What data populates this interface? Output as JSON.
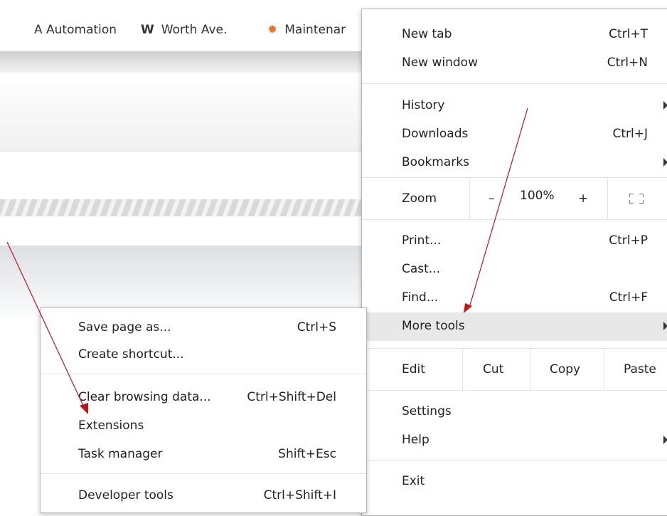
{
  "bookmarks": [
    {
      "icon": "automation-icon",
      "label": "A Automation"
    },
    {
      "icon": "worth-ave-icon",
      "glyph": "W",
      "label": "Worth Ave."
    },
    {
      "icon": "maintenance-icon",
      "glyph": "✹",
      "label": "Maintenar"
    }
  ],
  "main_menu": {
    "new_tab": {
      "label": "New tab",
      "shortcut": "Ctrl+T"
    },
    "new_window": {
      "label": "New window",
      "shortcut": "Ctrl+N"
    },
    "history": {
      "label": "History"
    },
    "downloads": {
      "label": "Downloads",
      "shortcut": "Ctrl+J"
    },
    "bookmarks": {
      "label": "Bookmarks"
    },
    "zoom": {
      "label": "Zoom",
      "minus": "–",
      "value": "100%",
      "plus": "+"
    },
    "print": {
      "label": "Print...",
      "shortcut": "Ctrl+P"
    },
    "cast": {
      "label": "Cast..."
    },
    "find": {
      "label": "Find...",
      "shortcut": "Ctrl+F"
    },
    "more_tools": {
      "label": "More tools"
    },
    "edit": {
      "label": "Edit",
      "cut": "Cut",
      "copy": "Copy",
      "paste": "Paste"
    },
    "settings": {
      "label": "Settings"
    },
    "help": {
      "label": "Help"
    },
    "exit": {
      "label": "Exit"
    }
  },
  "sub_menu": {
    "save_page": {
      "label": "Save page as...",
      "shortcut": "Ctrl+S"
    },
    "create_shortcut": {
      "label": "Create shortcut..."
    },
    "clear_browsing": {
      "label": "Clear browsing data...",
      "shortcut": "Ctrl+Shift+Del"
    },
    "extensions": {
      "label": "Extensions"
    },
    "task_manager": {
      "label": "Task manager",
      "shortcut": "Shift+Esc"
    },
    "developer_tools": {
      "label": "Developer tools",
      "shortcut": "Ctrl+Shift+I"
    }
  },
  "colors": {
    "annotation_arrow": "#c0141a",
    "highlight": "#e8e8e8",
    "maintenance_icon": "#e8722a"
  }
}
